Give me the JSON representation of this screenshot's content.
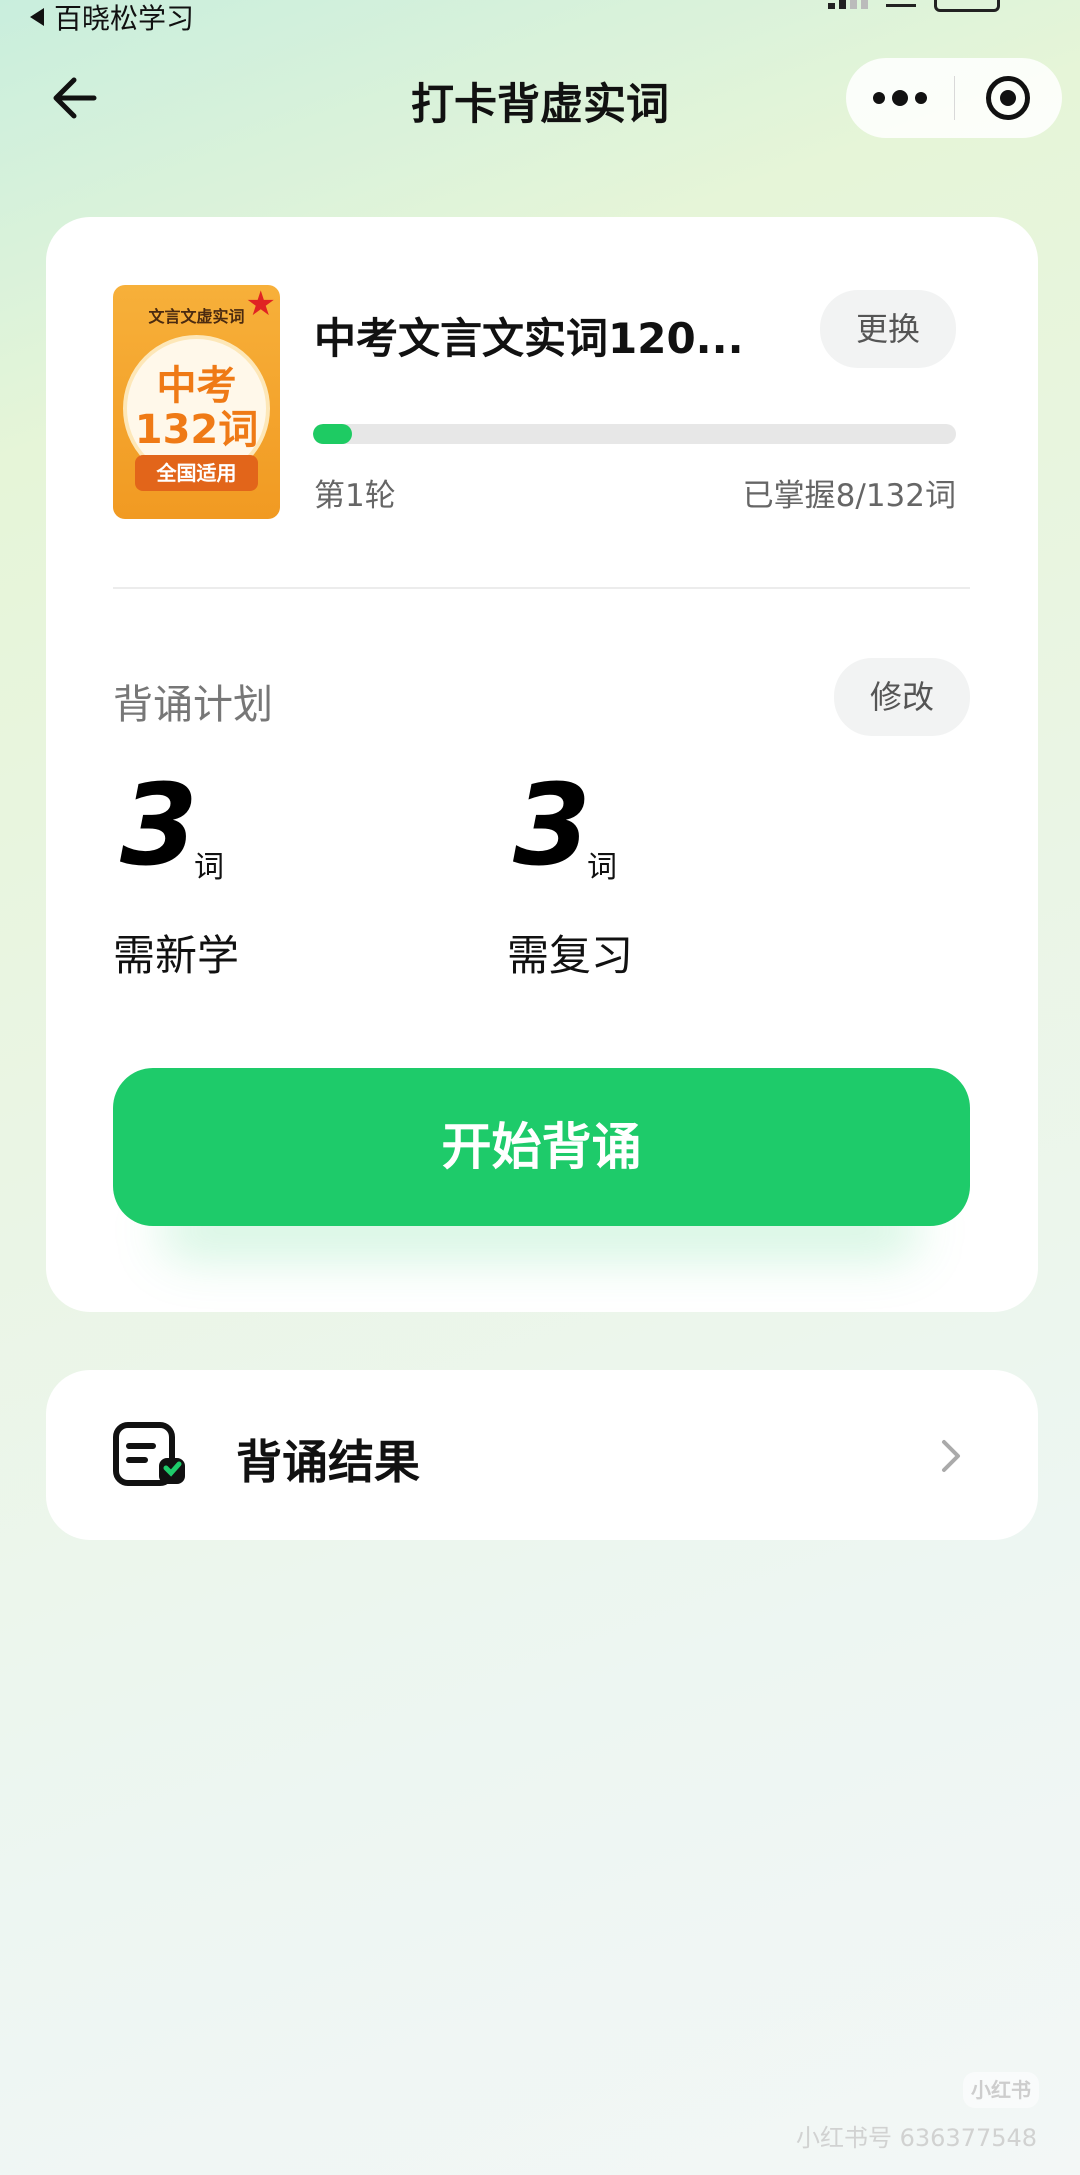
{
  "status_bar": {
    "back_app_label": "百晓松学习"
  },
  "nav": {
    "title": "打卡背虚实词"
  },
  "book": {
    "cover_heading": "文言文虚实词",
    "cover_line1": "中考",
    "cover_line2": "132词",
    "cover_badge": "全国适用",
    "title": "中考文言文实词120...",
    "change_label": "更换",
    "progress": 0.06,
    "round_label": "第1轮",
    "mastered_label": "已掌握8/132词"
  },
  "plan": {
    "title": "背诵计划",
    "edit_label": "修改",
    "new_count": "3",
    "new_unit": "词",
    "new_label": "需新学",
    "review_count": "3",
    "review_unit": "词",
    "review_label": "需复习"
  },
  "start_label": "开始背诵",
  "results": {
    "label": "背诵结果"
  },
  "watermark": {
    "logo_text": "小红书",
    "id_text": "小红书号 636377548"
  },
  "colors": {
    "accent": "#1ecb6a",
    "cover_orange": "#f19a22"
  }
}
